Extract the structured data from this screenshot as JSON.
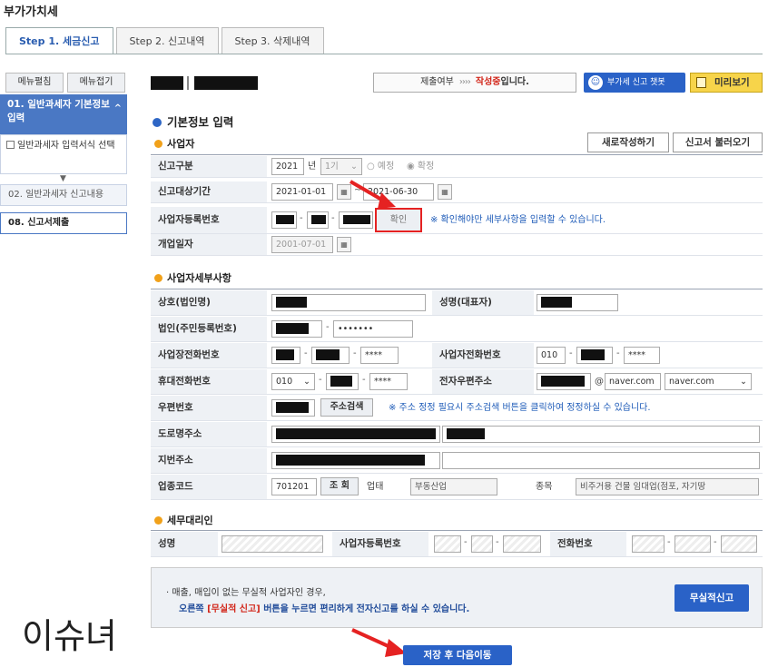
{
  "page_title": "부가가치세",
  "tabs": [
    "Step 1. 세금신고",
    "Step 2. 신고내역",
    "Step 3. 삭제내역"
  ],
  "sidebar": {
    "expand_label": "메뉴펼침",
    "collapse_label": "메뉴접기",
    "active_item": "01. 일반과세자 기본정보 입력",
    "sub_item": "일반과세자 입력서식 선택",
    "item2": "02. 일반과세자 신고내용",
    "item3": "08. 신고서제출"
  },
  "topbar": {
    "status_label": "제출여부",
    "status_arrows": "››››",
    "status_value": "작성중",
    "status_suffix": "입니다.",
    "chatbot_label": "부가세 신고 챗봇",
    "preview_label": "미리보기"
  },
  "basic_info_title": "기본정보 입력",
  "business_section": {
    "title": "사업자",
    "new_button": "새로작성하기",
    "load_button": "신고서 불러오기",
    "report_type_label": "신고구분",
    "year": "2021",
    "year_unit": "년",
    "period": "1기",
    "opt_preliminary": "예정",
    "opt_final": "확정",
    "target_period_label": "신고대상기간",
    "date_from": "2021-01-01",
    "date_to": "2021-06-30",
    "brn_label": "사업자등록번호",
    "confirm_button": "확인",
    "confirm_note": "※ 확인해야만 세부사항을 입력할 수 있습니다.",
    "open_date_label": "개업일자",
    "open_date": "2001-07-01"
  },
  "detail_section": {
    "title": "사업자세부사항",
    "company_label": "상호(법인명)",
    "ceo_label": "성명(대표자)",
    "corp_no_label": "법인(주민등록번호)",
    "corp_no_masked": "•••••••",
    "biz_phone_label": "사업장전화번호",
    "biz_phone_last": "****",
    "home_phone_label": "사업자전화번호",
    "home_phone_prefix": "010",
    "home_phone_last": "****",
    "mobile_label": "휴대전화번호",
    "mobile_prefix": "010",
    "mobile_last": "****",
    "email_label": "전자우편주소",
    "email_at": "@",
    "email_domain": "naver.com",
    "email_domain_select": "naver.com",
    "zip_label": "우편번호",
    "zip_button": "주소검색",
    "zip_note": "※ 주소 정정 필요시 주소검색 버튼을 클릭하여 정정하실 수 있습니다.",
    "road_addr_label": "도로명주소",
    "lot_addr_label": "지번주소",
    "industry_code_label": "업종코드",
    "industry_code": "701201",
    "lookup_button": "조 회",
    "business_type_label": "업태",
    "business_type": "부동산업",
    "item_label": "종목",
    "item_value": "비주거용 건물 임대업(점포, 자기땅"
  },
  "agent_section": {
    "title": "세무대리인",
    "name_label": "성명",
    "brn_label": "사업자등록번호",
    "phone_label": "전화번호"
  },
  "notice": {
    "line1": "· 매출, 매입이 없는 무실적 사업자인 경우,",
    "line2_pre": "오른쪽 ",
    "line2_red": "[무실적 신고]",
    "line2_post": " 버튼을 누르면 편리하게 전자신고를 하실 수 있습니다.",
    "button": "무실적신고"
  },
  "save_button": "저장 후 다음이동",
  "watermark": "이슈녀",
  "colors": {
    "accent": "#2a62c7",
    "highlight": "#e52222",
    "warning": "#f1a11a"
  }
}
